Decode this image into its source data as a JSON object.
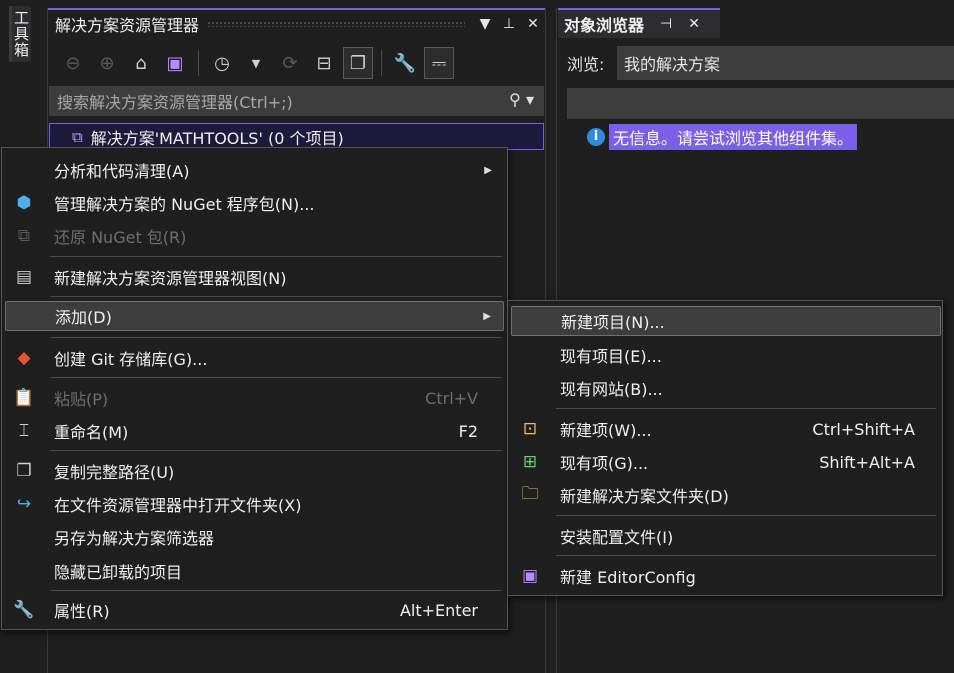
{
  "toolbox": {
    "label": "工具箱"
  },
  "solution_explorer": {
    "title": "解决方案资源管理器",
    "search_placeholder": "搜索解决方案资源管理器(Ctrl+;)",
    "solution_node": "解决方案'MATHTOOLS' (0 个项目)"
  },
  "object_browser": {
    "tab_title": "对象浏览器",
    "browse_label": "浏览:",
    "browse_value": "我的解决方案",
    "info_text": "无信息。请尝试浏览其他组件集。"
  },
  "context_menu": {
    "items": [
      {
        "label": "分析和代码清理(A)"
      },
      {
        "label": "管理解决方案的 NuGet 程序包(N)..."
      },
      {
        "label": "还原 NuGet 包(R)"
      },
      {
        "label": "新建解决方案资源管理器视图(N)"
      },
      {
        "label": "添加(D)"
      },
      {
        "label": "创建 Git 存储库(G)..."
      },
      {
        "label": "粘贴(P)",
        "shortcut": "Ctrl+V"
      },
      {
        "label": "重命名(M)",
        "shortcut": "F2"
      },
      {
        "label": "复制完整路径(U)"
      },
      {
        "label": "在文件资源管理器中打开文件夹(X)"
      },
      {
        "label": "另存为解决方案筛选器"
      },
      {
        "label": "隐藏已卸载的项目"
      },
      {
        "label": "属性(R)",
        "shortcut": "Alt+Enter"
      }
    ]
  },
  "add_submenu": {
    "items": [
      {
        "label": "新建项目(N)..."
      },
      {
        "label": "现有项目(E)..."
      },
      {
        "label": "现有网站(B)..."
      },
      {
        "label": "新建项(W)...",
        "shortcut": "Ctrl+Shift+A"
      },
      {
        "label": "现有项(G)...",
        "shortcut": "Shift+Alt+A"
      },
      {
        "label": "新建解决方案文件夹(D)"
      },
      {
        "label": "安装配置文件(I)"
      },
      {
        "label": "新建 EditorConfig"
      }
    ]
  }
}
